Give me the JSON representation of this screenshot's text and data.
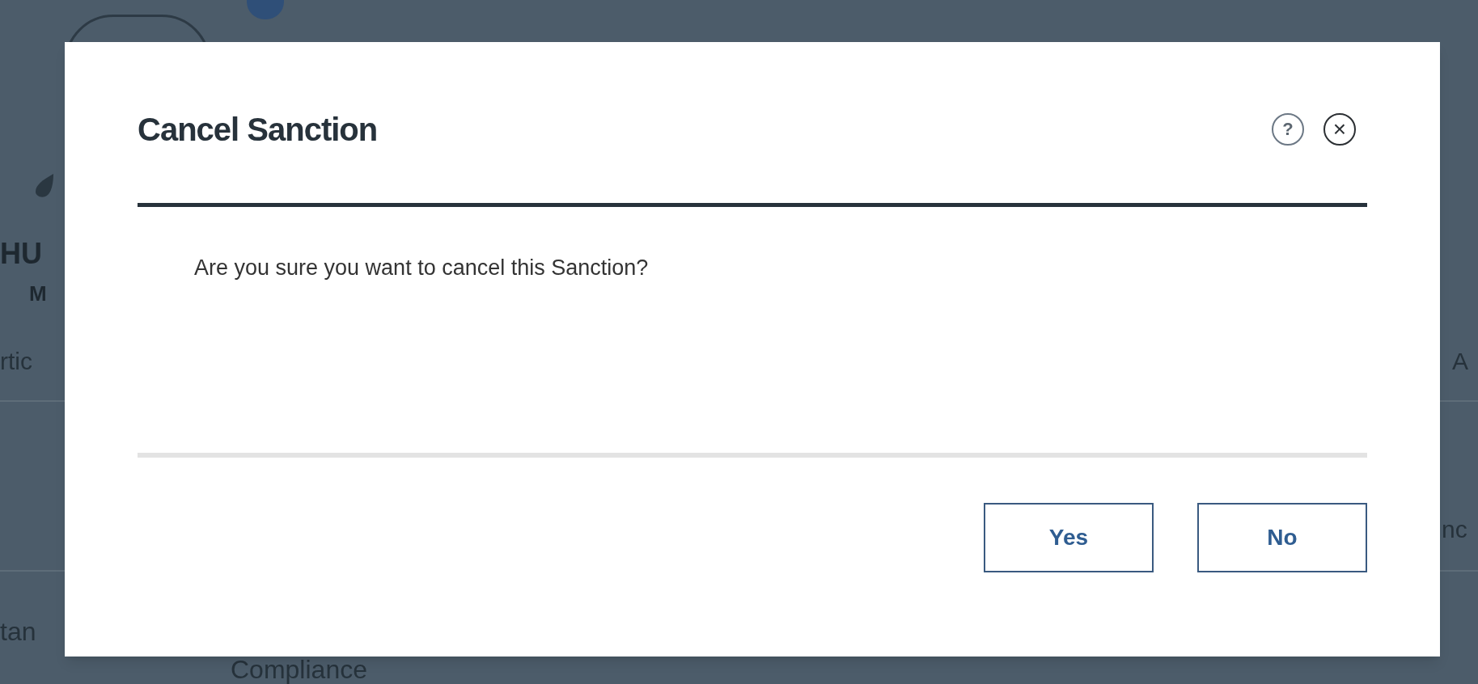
{
  "background": {
    "fragments": [
      {
        "text": "HU",
        "kind": "name"
      },
      {
        "text": "M",
        "kind": "subname"
      },
      {
        "text": "rtic",
        "kind": "tab_left"
      },
      {
        "text": "A",
        "kind": "tab_right"
      },
      {
        "text": "nc",
        "kind": "row_right"
      },
      {
        "text": "tan",
        "kind": "row_left"
      },
      {
        "text": "Compliance",
        "kind": "row_label"
      }
    ]
  },
  "dialog": {
    "title": "Cancel Sanction",
    "help": "?",
    "close": "×",
    "message": "Are you sure you want to cancel this Sanction?",
    "buttons": [
      "Yes",
      "No"
    ]
  }
}
